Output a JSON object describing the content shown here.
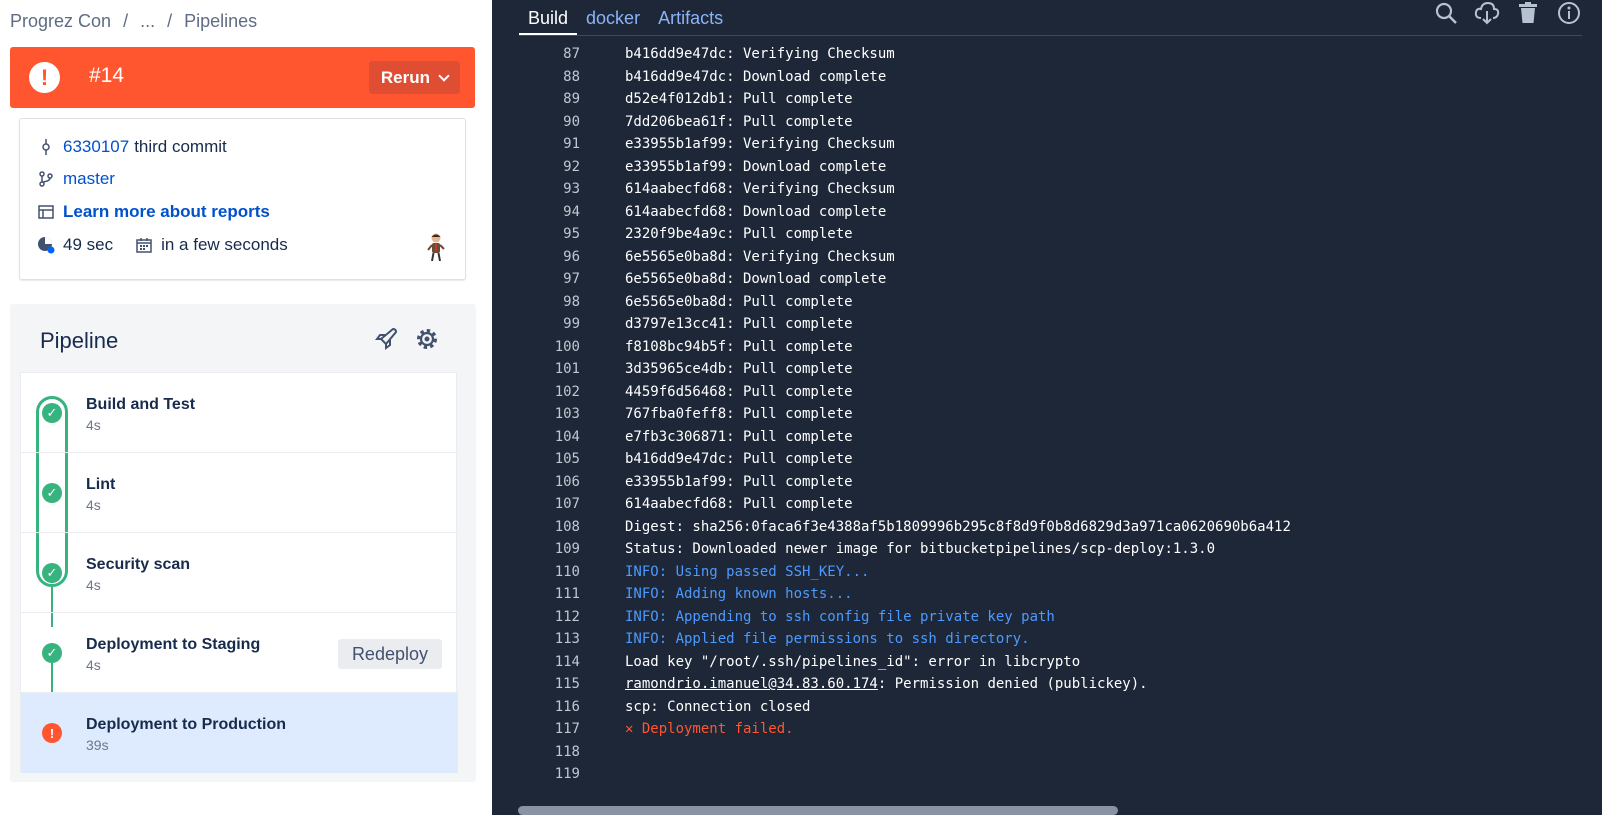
{
  "breadcrumbs": [
    "Progrez Con",
    "...",
    "Pipelines"
  ],
  "status": {
    "number": "#14",
    "rerun_label": "Rerun",
    "color": "#ff5630"
  },
  "details": {
    "commit_hash": "6330107",
    "commit_message": "third commit",
    "branch": "master",
    "reports_link": "Learn more about reports",
    "duration": "49 sec",
    "when": "in a few seconds"
  },
  "pipeline": {
    "title": "Pipeline",
    "steps": [
      {
        "name": "Build and Test",
        "duration": "4s",
        "status": "success"
      },
      {
        "name": "Lint",
        "duration": "4s",
        "status": "success"
      },
      {
        "name": "Security scan",
        "duration": "4s",
        "status": "success"
      },
      {
        "name": "Deployment to Staging",
        "duration": "4s",
        "status": "success",
        "action": "Redeploy"
      },
      {
        "name": "Deployment to Production",
        "duration": "39s",
        "status": "failed"
      }
    ]
  },
  "log_panel": {
    "tabs": [
      "Build",
      "docker",
      "Artifacts"
    ],
    "selected_tab": "Build",
    "lines": [
      {
        "n": "87",
        "t": "b416dd9e47dc: Verifying Checksum",
        "k": "normal"
      },
      {
        "n": "88",
        "t": "b416dd9e47dc: Download complete",
        "k": "normal"
      },
      {
        "n": "89",
        "t": "d52e4f012db1: Pull complete",
        "k": "normal"
      },
      {
        "n": "90",
        "t": "7dd206bea61f: Pull complete",
        "k": "normal"
      },
      {
        "n": "91",
        "t": "e33955b1af99: Verifying Checksum",
        "k": "normal"
      },
      {
        "n": "92",
        "t": "e33955b1af99: Download complete",
        "k": "normal"
      },
      {
        "n": "93",
        "t": "614aabecfd68: Verifying Checksum",
        "k": "normal"
      },
      {
        "n": "94",
        "t": "614aabecfd68: Download complete",
        "k": "normal"
      },
      {
        "n": "95",
        "t": "2320f9be4a9c: Pull complete",
        "k": "normal"
      },
      {
        "n": "96",
        "t": "6e5565e0ba8d: Verifying Checksum",
        "k": "normal"
      },
      {
        "n": "97",
        "t": "6e5565e0ba8d: Download complete",
        "k": "normal"
      },
      {
        "n": "98",
        "t": "6e5565e0ba8d: Pull complete",
        "k": "normal"
      },
      {
        "n": "99",
        "t": "d3797e13cc41: Pull complete",
        "k": "normal"
      },
      {
        "n": "100",
        "t": "f8108bc94b5f: Pull complete",
        "k": "normal"
      },
      {
        "n": "101",
        "t": "3d35965ce4db: Pull complete",
        "k": "normal"
      },
      {
        "n": "102",
        "t": "4459f6d56468: Pull complete",
        "k": "normal"
      },
      {
        "n": "103",
        "t": "767fba0feff8: Pull complete",
        "k": "normal"
      },
      {
        "n": "104",
        "t": "e7fb3c306871: Pull complete",
        "k": "normal"
      },
      {
        "n": "105",
        "t": "b416dd9e47dc: Pull complete",
        "k": "normal"
      },
      {
        "n": "106",
        "t": "e33955b1af99: Pull complete",
        "k": "normal"
      },
      {
        "n": "107",
        "t": "614aabecfd68: Pull complete",
        "k": "normal"
      },
      {
        "n": "108",
        "t": "Digest: sha256:0faca6f3e4388af5b1809996b295c8f8d9f0b8d6829d3a971ca0620690b6a412",
        "k": "normal"
      },
      {
        "n": "109",
        "t": "Status: Downloaded newer image for bitbucketpipelines/scp-deploy:1.3.0",
        "k": "normal"
      },
      {
        "n": "110",
        "t": "INFO: Using passed SSH_KEY...",
        "k": "info"
      },
      {
        "n": "111",
        "t": "INFO: Adding known hosts...",
        "k": "info"
      },
      {
        "n": "112",
        "t": "INFO: Appending to ssh config file private key path",
        "k": "info"
      },
      {
        "n": "113",
        "t": "INFO: Applied file permissions to ssh directory.",
        "k": "info"
      },
      {
        "n": "114",
        "t": "Load key \"/root/.ssh/pipelines_id\": error in libcrypto",
        "k": "normal"
      },
      {
        "n": "115",
        "t": "ramondrio.imanuel@34.83.60.174",
        "t2": ": Permission denied (publickey).",
        "k": "link"
      },
      {
        "n": "116",
        "t": "scp: Connection closed",
        "k": "normal"
      },
      {
        "n": "117",
        "t": "✕ Deployment failed.",
        "k": "err"
      },
      {
        "n": "118",
        "t": "",
        "k": "normal"
      },
      {
        "n": "119",
        "t": "",
        "k": "normal"
      }
    ]
  }
}
